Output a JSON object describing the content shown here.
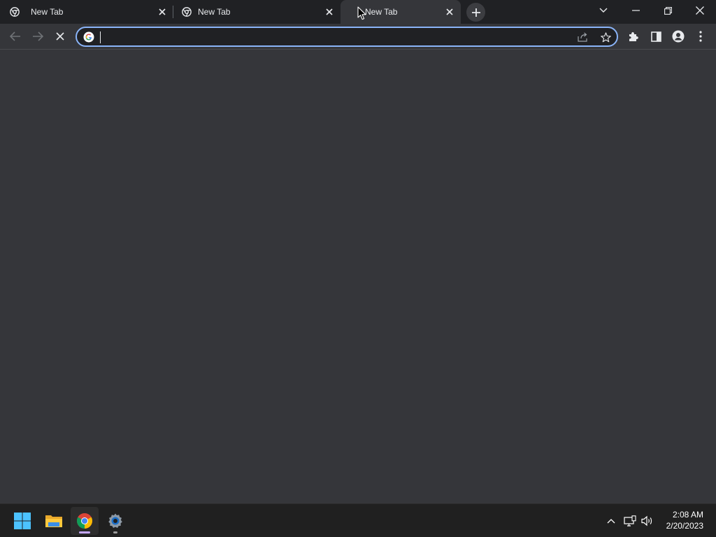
{
  "tabs": [
    {
      "title": "New Tab",
      "close_label": "✕"
    },
    {
      "title": "New Tab",
      "close_label": "✕"
    },
    {
      "title": "New Tab",
      "close_label": "✕"
    }
  ],
  "omnibox": {
    "value": "",
    "placeholder": ""
  },
  "taskbar": {
    "time": "2:08 AM",
    "date": "2/20/2023"
  },
  "colors": {
    "chrome_dark": "#202124",
    "chrome_toolbar": "#35363a",
    "focus_ring": "#8ab4f8",
    "taskbar": "#202020"
  },
  "icons": [
    "chrome-favicon-icon",
    "close-icon",
    "plus-icon",
    "chevron-down-icon",
    "minimize-icon",
    "restore-icon",
    "back-icon",
    "forward-icon",
    "stop-icon",
    "google-icon",
    "share-icon",
    "star-icon",
    "extensions-icon",
    "side-panel-icon",
    "profile-icon",
    "menu-icon",
    "windows-start-icon",
    "file-explorer-icon",
    "chrome-icon",
    "settings-icon",
    "chevron-up-icon",
    "network-icon",
    "volume-icon"
  ]
}
